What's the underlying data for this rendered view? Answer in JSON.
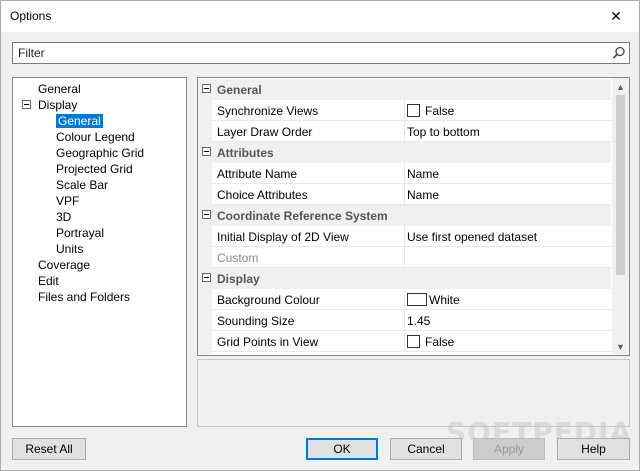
{
  "window": {
    "title": "Options",
    "close_glyph": "✕"
  },
  "filter": {
    "placeholder": "Filter",
    "value": ""
  },
  "tree": {
    "items": [
      {
        "label": "General",
        "level": 0
      },
      {
        "label": "Display",
        "level": 0,
        "expanded": true
      },
      {
        "label": "General",
        "level": 1,
        "selected": true
      },
      {
        "label": "Colour Legend",
        "level": 1
      },
      {
        "label": "Geographic Grid",
        "level": 1
      },
      {
        "label": "Projected Grid",
        "level": 1
      },
      {
        "label": "Scale Bar",
        "level": 1
      },
      {
        "label": "VPF",
        "level": 1
      },
      {
        "label": "3D",
        "level": 1
      },
      {
        "label": "Portrayal",
        "level": 1
      },
      {
        "label": "Units",
        "level": 1
      },
      {
        "label": "Coverage",
        "level": 0
      },
      {
        "label": "Edit",
        "level": 0
      },
      {
        "label": "Files and Folders",
        "level": 0
      }
    ]
  },
  "grid": {
    "rows": [
      {
        "type": "category",
        "label": "General"
      },
      {
        "type": "checkbox",
        "name": "Synchronize Views",
        "value": "False",
        "checked": false
      },
      {
        "type": "text",
        "name": "Layer Draw Order",
        "value": "Top to bottom"
      },
      {
        "type": "category",
        "label": "Attributes"
      },
      {
        "type": "text",
        "name": "Attribute Name",
        "value": "Name"
      },
      {
        "type": "text",
        "name": "Choice Attributes",
        "value": "Name"
      },
      {
        "type": "category",
        "label": "Coordinate Reference System"
      },
      {
        "type": "text",
        "name": "Initial Display of 2D View",
        "value": "Use first opened dataset"
      },
      {
        "type": "text",
        "name": "Custom",
        "value": "",
        "disabled": true
      },
      {
        "type": "category",
        "label": "Display"
      },
      {
        "type": "color",
        "name": "Background Colour",
        "value": "White",
        "color": "#ffffff"
      },
      {
        "type": "text",
        "name": "Sounding Size",
        "value": "1.45"
      },
      {
        "type": "checkbox",
        "name": "Grid Points in View",
        "value": "False",
        "checked": false
      }
    ]
  },
  "buttons": {
    "reset_all": "Reset All",
    "ok": "OK",
    "cancel": "Cancel",
    "apply": "Apply",
    "help": "Help"
  },
  "watermark": "SOFTPEDIA",
  "colors": {
    "selection": "#0078d7",
    "category_bg": "#f0f0f0",
    "window_bg": "#f0f0f0"
  },
  "icons": {
    "filter": "search-icon",
    "close": "close-icon"
  }
}
